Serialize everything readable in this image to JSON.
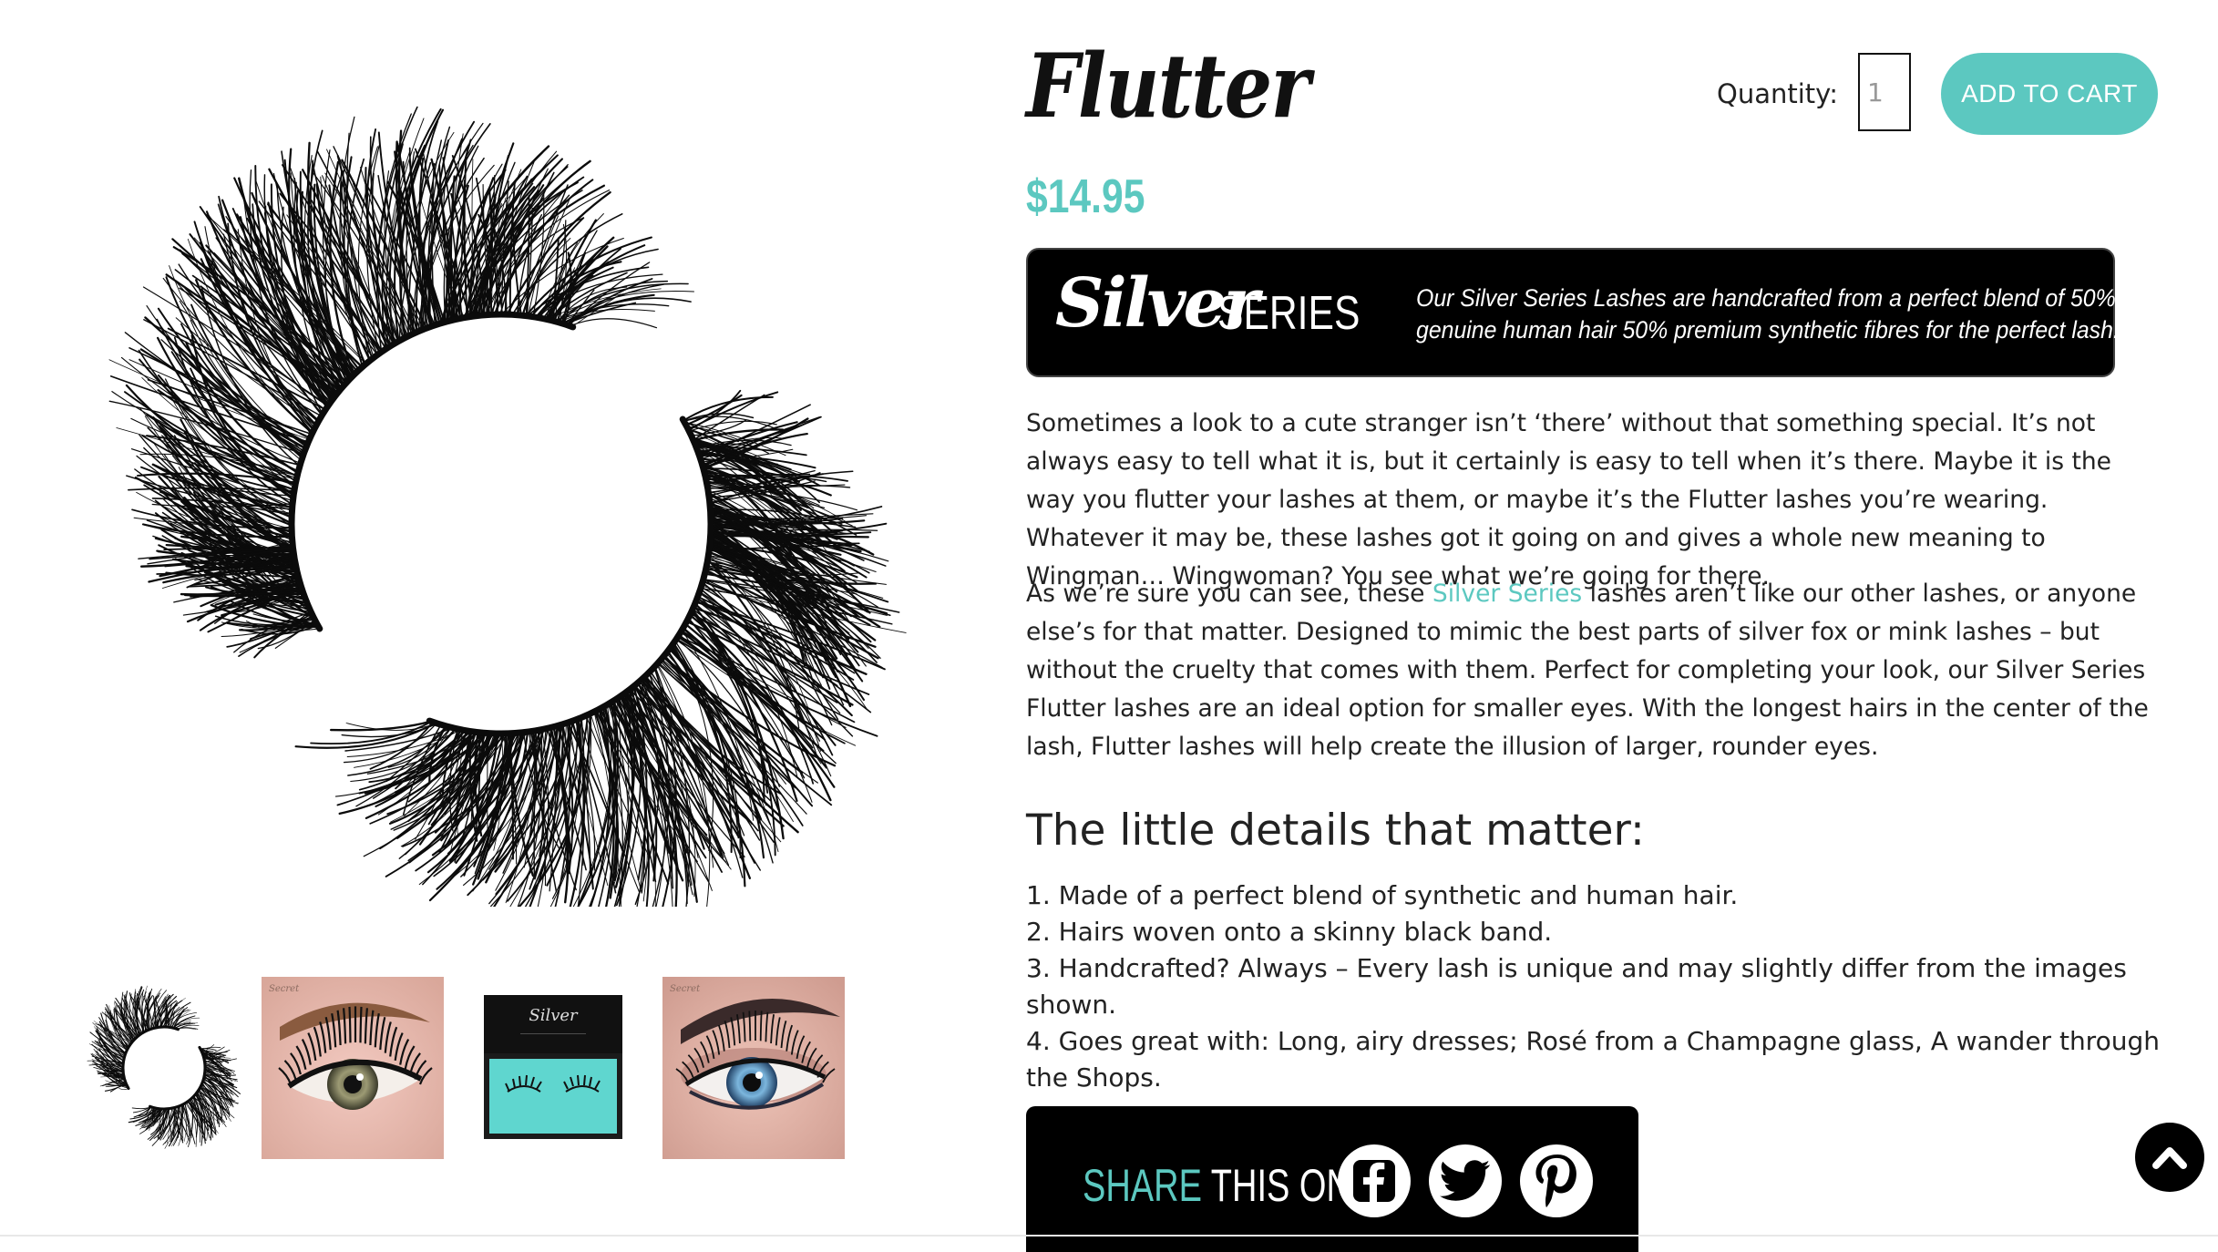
{
  "product": {
    "title": "Flutter",
    "price": "$14.95"
  },
  "purchase": {
    "quantity_label": "Quantity:",
    "quantity_value": "1",
    "add_to_cart_label": "ADD TO CART"
  },
  "banner": {
    "script_word": "Silver",
    "series_word": "SERIES",
    "line_1": "Our Silver Series Lashes are handcrafted from a perfect blend of 50%",
    "line_2": "genuine human hair 50% premium synthetic fibres for the perfect lash."
  },
  "description": {
    "paragraph_1": "Sometimes a look to a cute stranger isn’t ‘there’ without that something special. It’s not always easy to tell what it is, but it certainly is easy to tell when it’s there. Maybe it is the way you flutter your lashes at them, or maybe it’s the Flutter lashes you’re wearing. Whatever it may be, these lashes got it going on and gives a whole new meaning to Wingman… Wingwoman? You see what we’re going for there.",
    "paragraph_2_before": "As we’re sure you can see, these ",
    "paragraph_2_link": "Silver Series",
    "paragraph_2_after": " lashes aren’t like our other lashes, or anyone else’s for that matter. Designed to mimic the best parts of silver fox or mink lashes – but without the cruelty that comes with them. Perfect for completing your look, our Silver Series Flutter lashes are an ideal option for smaller eyes. With the longest hairs in the center of the lash, Flutter lashes will help create the illusion of larger, rounder eyes."
  },
  "details": {
    "heading": "The little details that matter:",
    "items": [
      "1. Made of a perfect blend of synthetic and human hair.",
      "2. Hairs woven onto a skinny black band.",
      "3. Handcrafted? Always – Every lash is unique and may slightly differ from the images shown.",
      "4. Goes great with: Long, airy dresses; Rosé from a Champagne glass, A wander through the Shops."
    ]
  },
  "share": {
    "word_1": "SHARE",
    "word_2": " THIS ON",
    "icons": [
      "facebook-icon",
      "twitter-icon",
      "pinterest-icon"
    ]
  },
  "thumbnails": [
    "lash-product",
    "eye-model-brown",
    "lash-box-case",
    "eye-model-blue"
  ],
  "colors": {
    "accent": "#5cc8c0",
    "banner_bg": "#000000",
    "text": "#222222"
  }
}
